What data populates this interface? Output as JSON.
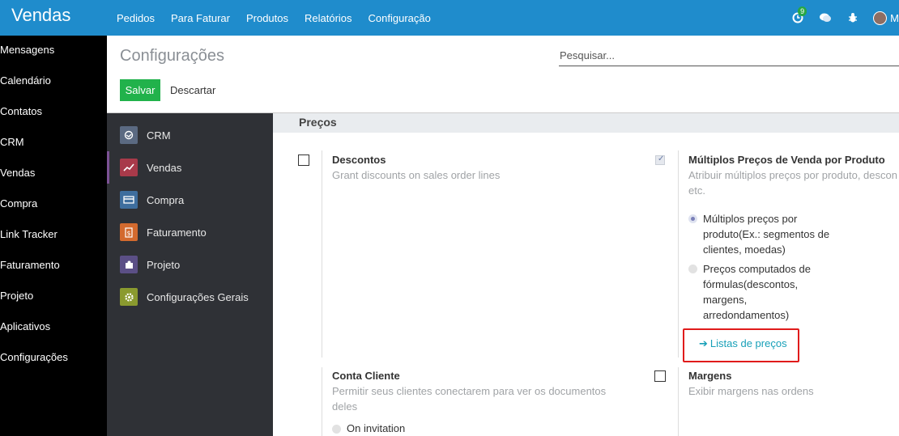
{
  "app": {
    "title": "Vendas"
  },
  "topmenu": [
    "Pedidos",
    "Para Faturar",
    "Produtos",
    "Relatórios",
    "Configuração"
  ],
  "topbar": {
    "activity_badge": "9",
    "user_initial": "M"
  },
  "leftnav": [
    "Mensagens",
    "Calendário",
    "Contatos",
    "CRM",
    "Vendas",
    "Compra",
    "Link Tracker",
    "Faturamento",
    "Projeto",
    "Aplicativos",
    "Configurações"
  ],
  "control_panel": {
    "title": "Configurações",
    "search_placeholder": "Pesquisar...",
    "save_label": "Salvar",
    "discard_label": "Descartar"
  },
  "settings_nav": [
    {
      "label": "CRM",
      "color": "#5b6a82"
    },
    {
      "label": "Vendas",
      "color": "#a83a4a"
    },
    {
      "label": "Compra",
      "color": "#3e6e9e"
    },
    {
      "label": "Faturamento",
      "color": "#d36a2e"
    },
    {
      "label": "Projeto",
      "color": "#5b4f86"
    },
    {
      "label": "Configurações Gerais",
      "color": "#8a9a2f"
    }
  ],
  "section": {
    "title": "Preços"
  },
  "settings": {
    "descontos": {
      "title": "Descontos",
      "desc": "Grant discounts on sales order lines"
    },
    "multi_prices": {
      "title": "Múltiplos Preços de Venda por Produto",
      "desc_line1": "Atribuir múltiplos preços por produto, descon",
      "desc_line2": "etc.",
      "option1": [
        "Múltiplos preços por",
        "produto(Ex.: segmentos de",
        "clientes, moedas)"
      ],
      "option2": [
        "Preços computados de",
        "fórmulas(descontos,",
        "margens,",
        "arredondamentos)"
      ],
      "link": "Listas de preços"
    },
    "conta_cliente": {
      "title": "Conta Cliente",
      "desc_line1": "Permitir seus clientes conectarem para ver os documentos",
      "desc_line2": "deles",
      "option1": "On invitation"
    },
    "margens": {
      "title": "Margens",
      "desc": "Exibir margens nas ordens"
    }
  },
  "colors": {
    "topbar": "#1f8ccc",
    "save": "#21b24b",
    "highlight": "#e01b1b",
    "link": "#18a0b8"
  }
}
